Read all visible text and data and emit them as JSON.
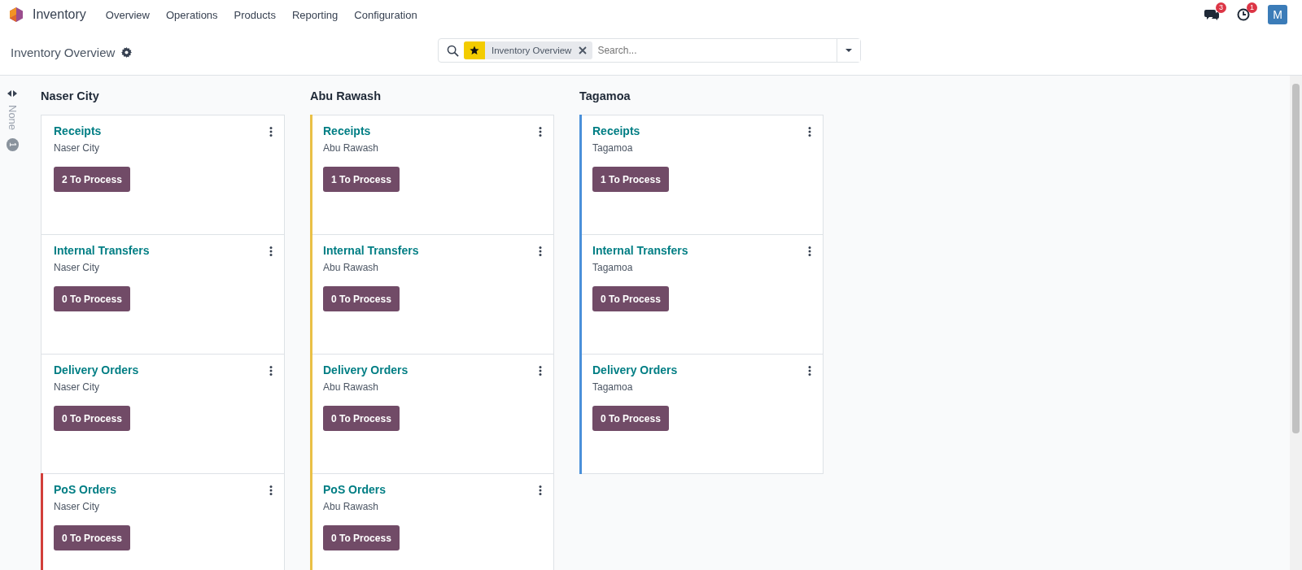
{
  "navbar": {
    "app_name": "Inventory",
    "menu": [
      "Overview",
      "Operations",
      "Products",
      "Reporting",
      "Configuration"
    ],
    "messages_count": "3",
    "activities_count": "1",
    "avatar": "M"
  },
  "control_panel": {
    "title": "Inventory Overview",
    "search": {
      "facet": "Inventory Overview",
      "placeholder": "Search..."
    }
  },
  "folded_column": {
    "title": "None",
    "count": "1"
  },
  "columns": [
    {
      "title": "Naser City",
      "cards": [
        {
          "name": "Receipts",
          "warehouse": "Naser City",
          "action": "2 To Process"
        },
        {
          "name": "Internal Transfers",
          "warehouse": "Naser City",
          "action": "0 To Process"
        },
        {
          "name": "Delivery Orders",
          "warehouse": "Naser City",
          "action": "0 To Process"
        },
        {
          "name": "PoS Orders",
          "warehouse": "Naser City",
          "action": "0 To Process",
          "color": "#d23f3a"
        }
      ]
    },
    {
      "title": "Abu Rawash",
      "cards": [
        {
          "name": "Receipts",
          "warehouse": "Abu Rawash",
          "action": "1 To Process",
          "color": "#e9c046"
        },
        {
          "name": "Internal Transfers",
          "warehouse": "Abu Rawash",
          "action": "0 To Process",
          "color": "#e9c046"
        },
        {
          "name": "Delivery Orders",
          "warehouse": "Abu Rawash",
          "action": "0 To Process",
          "color": "#e9c046"
        },
        {
          "name": "PoS Orders",
          "warehouse": "Abu Rawash",
          "action": "0 To Process",
          "color": "#e9c046"
        }
      ]
    },
    {
      "title": "Tagamoa",
      "cards": [
        {
          "name": "Receipts",
          "warehouse": "Tagamoa",
          "action": "1 To Process",
          "color": "#4a90d9"
        },
        {
          "name": "Internal Transfers",
          "warehouse": "Tagamoa",
          "action": "0 To Process",
          "color": "#4a90d9"
        },
        {
          "name": "Delivery Orders",
          "warehouse": "Tagamoa",
          "action": "0 To Process",
          "color": "#4a90d9"
        }
      ]
    }
  ]
}
